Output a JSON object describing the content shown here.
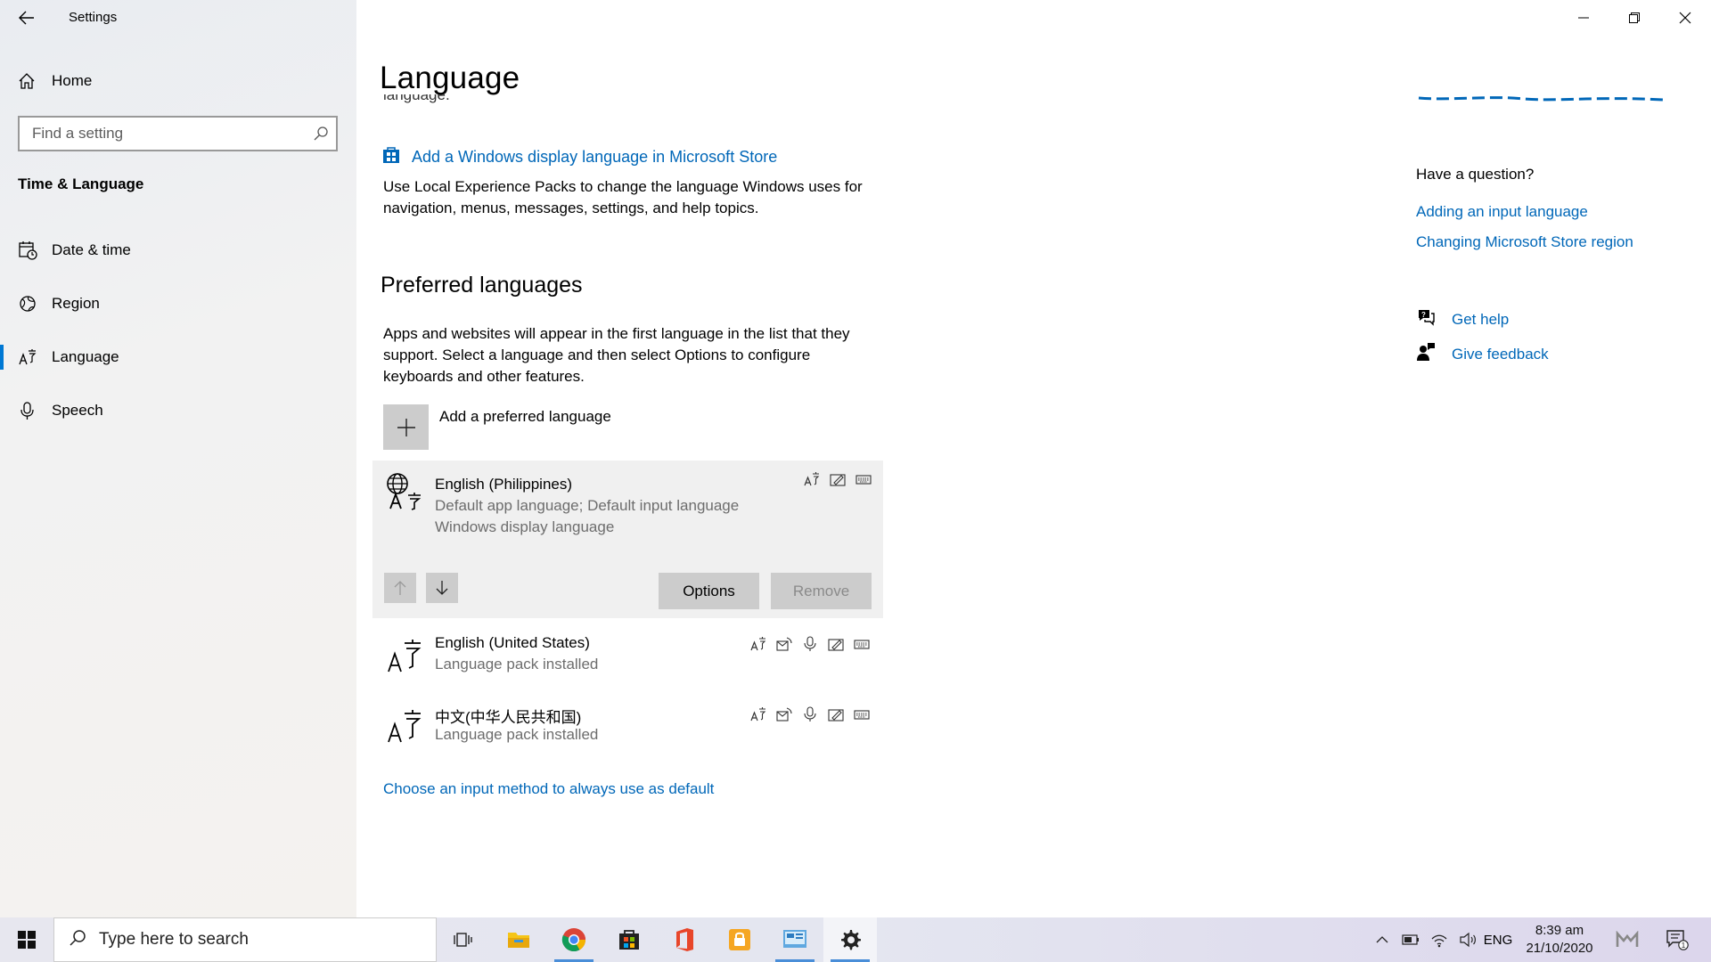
{
  "window": {
    "title": "Settings"
  },
  "sidebar": {
    "home_label": "Home",
    "search_placeholder": "Find a setting",
    "section_title": "Time & Language",
    "items": [
      {
        "label": "Date & time",
        "icon": "calendar-clock-icon"
      },
      {
        "label": "Region",
        "icon": "globe-icon"
      },
      {
        "label": "Language",
        "icon": "language-icon",
        "active": true
      },
      {
        "label": "Speech",
        "icon": "microphone-icon"
      }
    ]
  },
  "main": {
    "page_title": "Language",
    "cut_text": "language.",
    "store_link": "Add a Windows display language in Microsoft Store",
    "store_desc": "Use Local Experience Packs to change the language Windows uses for navigation, menus, messages, settings, and help topics.",
    "preferred_title": "Preferred languages",
    "preferred_desc": "Apps and websites will appear in the first language in the list that they support. Select a language and then select Options to configure keyboards and other features.",
    "add_language": "Add a preferred language",
    "languages": [
      {
        "name": "English (Philippines)",
        "sub1": "Default app language; Default input language",
        "sub2": "Windows display language",
        "features": [
          "display-language-icon",
          "handwriting-icon",
          "keyboard-icon"
        ]
      },
      {
        "name": "English (United States)",
        "sub1": "Language pack installed",
        "features": [
          "display-language-icon",
          "text-to-speech-icon",
          "speech-icon",
          "handwriting-icon",
          "keyboard-icon"
        ]
      },
      {
        "name": "中文(中华人民共和国)",
        "sub1": "Language pack installed",
        "features": [
          "display-language-icon",
          "text-to-speech-icon",
          "speech-icon",
          "handwriting-icon",
          "keyboard-icon"
        ]
      }
    ],
    "options_label": "Options",
    "remove_label": "Remove",
    "choose_link": "Choose an input method to always use as default"
  },
  "right": {
    "question": "Have a question?",
    "links": [
      "Adding an input language",
      "Changing Microsoft Store region"
    ],
    "get_help": "Get help",
    "give_feedback": "Give feedback"
  },
  "taskbar": {
    "search_placeholder": "Type here to search",
    "apps": [
      "task-view-icon",
      "file-explorer-icon",
      "chrome-icon",
      "microsoft-store-icon",
      "office-icon",
      "lock-app-icon",
      "control-panel-icon",
      "settings-gear-icon"
    ],
    "lang_indicator": "ENG",
    "time": "8:39 am",
    "date": "21/10/2020",
    "notification_count": "1"
  },
  "colors": {
    "accent": "#0078d4",
    "link": "#0067b8"
  }
}
